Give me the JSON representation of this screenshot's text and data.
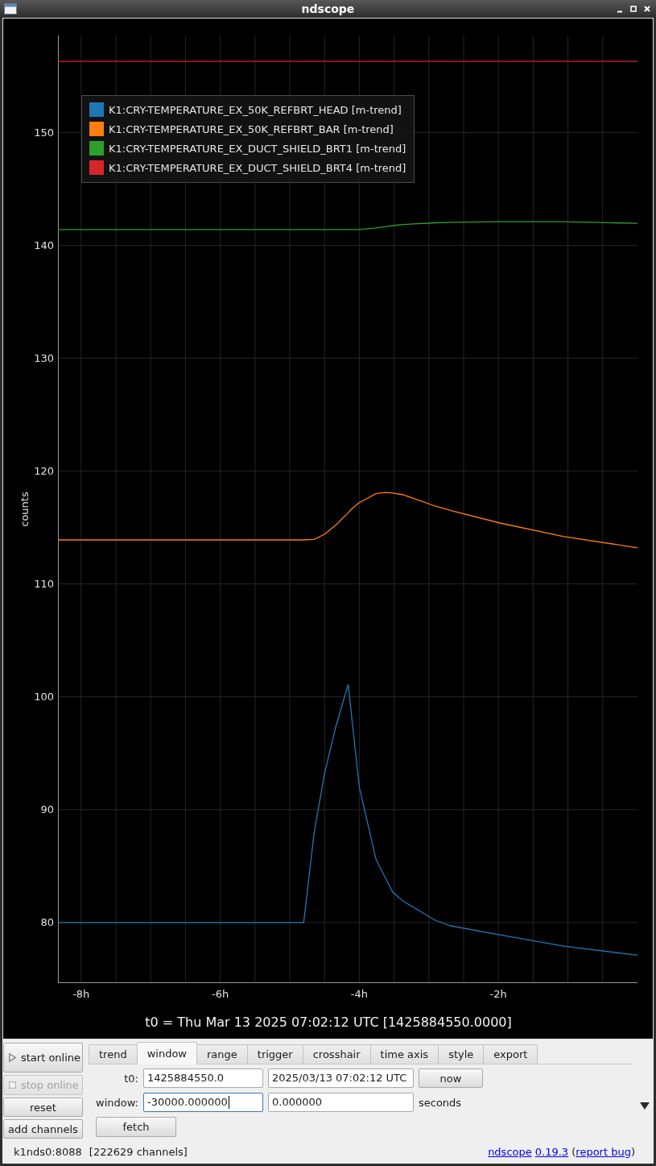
{
  "window": {
    "title": "ndscope"
  },
  "plot": {
    "chart_data": {
      "type": "line",
      "xlabel": "t0 = Thu Mar 13 2025 07:02:12 UTC [1425884550.0000]",
      "ylabel": "counts",
      "x": [
        -8.333,
        -4.8,
        -4.65,
        -4.5,
        -4.34,
        -4.16,
        -4.1,
        -4.0,
        -3.76,
        -3.63,
        -3.52,
        -3.37,
        -2.91,
        -2.68,
        -1.98,
        -1.06,
        0
      ],
      "series": [
        {
          "name": "K1:CRY-TEMPERATURE_EX_50K_REFBRT_HEAD [m-trend]",
          "color": "#1f77b4",
          "values": [
            80,
            80,
            87.9,
            93.2,
            97.3,
            101.1,
            97.7,
            92.0,
            85.6,
            84.0,
            82.7,
            81.9,
            80.2,
            79.7,
            78.9,
            77.9,
            77.1
          ]
        },
        {
          "name": "K1:CRY-TEMPERATURE_EX_50K_REFBRT_BAR [m-trend]",
          "color": "#ff7f0e",
          "values": [
            113.9,
            113.9,
            113.95,
            114.4,
            115.2,
            116.3,
            116.7,
            117.2,
            118.0,
            118.1,
            118.05,
            117.9,
            116.9,
            116.5,
            115.4,
            114.2,
            113.2
          ]
        },
        {
          "name": "K1:CRY-TEMPERATURE_EX_DUCT_SHIELD_BRT1 [m-trend]",
          "color": "#2ca02c",
          "values": [
            141.4,
            141.4,
            141.4,
            141.4,
            141.4,
            141.4,
            141.4,
            141.4,
            141.55,
            141.65,
            141.75,
            141.85,
            142.0,
            142.05,
            142.1,
            142.1,
            141.95
          ]
        },
        {
          "name": "K1:CRY-TEMPERATURE_EX_DUCT_SHIELD_BRT4 [m-trend]",
          "color": "#d62728",
          "values": [
            156.3,
            156.3,
            156.3,
            156.3,
            156.3,
            156.3,
            156.3,
            156.3,
            156.3,
            156.3,
            156.3,
            156.3,
            156.3,
            156.3,
            156.3,
            156.3,
            156.3
          ]
        }
      ],
      "xlim": [
        -8.333,
        0
      ],
      "ylim": [
        74.7,
        158.6
      ],
      "xticks": [
        {
          "value": -8,
          "label": "-8h"
        },
        {
          "value": -6,
          "label": "-6h"
        },
        {
          "value": -4,
          "label": "-4h"
        },
        {
          "value": -2,
          "label": "-2h"
        }
      ],
      "yticks": [
        80,
        90,
        100,
        110,
        120,
        130,
        140,
        150
      ],
      "grid": true,
      "legend": true
    }
  },
  "controls": {
    "buttons": [
      {
        "kind": "start",
        "label": "start online",
        "disabled": false
      },
      {
        "kind": "stop",
        "label": "stop online",
        "disabled": true
      },
      {
        "kind": "reset",
        "label": "reset",
        "disabled": false
      },
      {
        "kind": "add",
        "label": "add channels",
        "disabled": false
      }
    ],
    "tabs": [
      {
        "label": "trend",
        "selected": false
      },
      {
        "label": "window",
        "selected": true
      },
      {
        "label": "range",
        "selected": false
      },
      {
        "label": "trigger",
        "selected": false
      },
      {
        "label": "crosshair",
        "selected": false
      },
      {
        "label": "time axis",
        "selected": false
      },
      {
        "label": "style",
        "selected": false
      },
      {
        "label": "export",
        "selected": false
      }
    ],
    "t0_row": {
      "label": "t0:",
      "fields": [
        {
          "value": "1425884550.0",
          "focused": false
        },
        {
          "value": "2025/03/13 07:02:12 UTC",
          "focused": false
        }
      ],
      "button": "now"
    },
    "window_row": {
      "label": "window:",
      "fields": [
        {
          "value": "-30000.000000",
          "focused": true
        },
        {
          "value": "0.000000",
          "focused": false
        }
      ],
      "unit": "seconds"
    },
    "fetch_button": "fetch"
  },
  "status_bar": {
    "server": "k1nds0:8088",
    "channels": "[222629 channels]",
    "about": [
      {
        "kind": "link",
        "text": "ndscope"
      },
      {
        "kind": "link",
        "text": "0.19.3"
      },
      {
        "kind": "plain",
        "text": " ("
      },
      {
        "kind": "link",
        "text": "report bug"
      },
      {
        "kind": "plain",
        "text": ")"
      }
    ]
  }
}
